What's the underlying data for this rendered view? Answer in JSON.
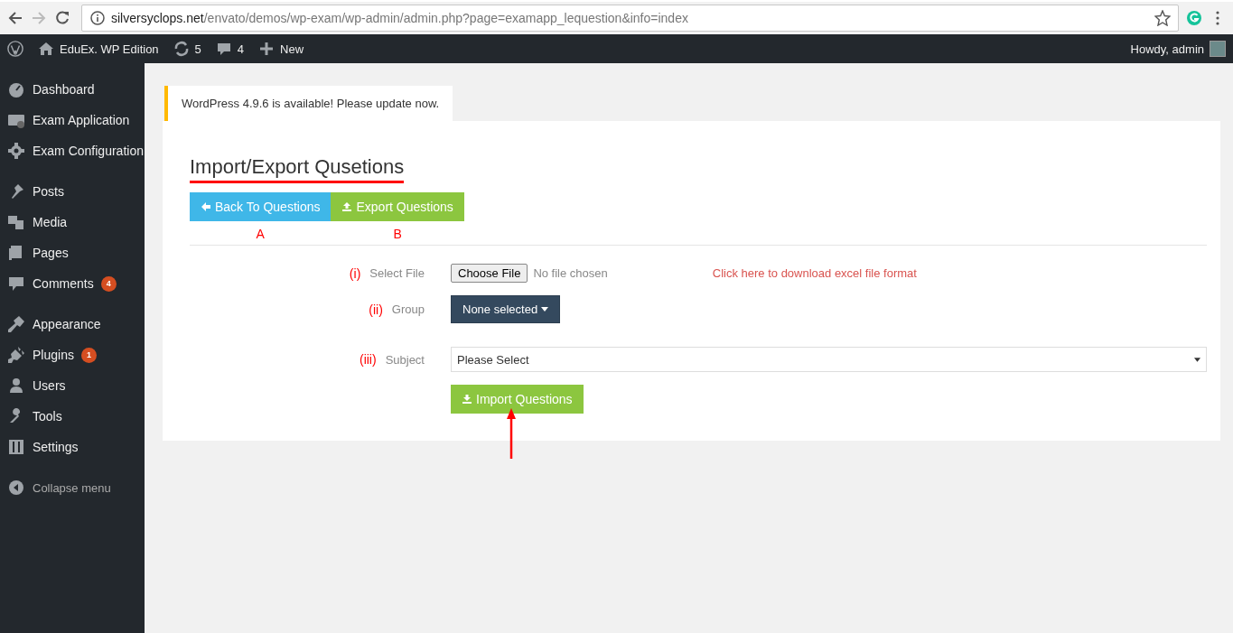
{
  "browser": {
    "url_host": "silversyclops.net",
    "url_path": "/envato/demos/wp-exam/wp-admin/admin.php?page=examapp_lequestion&info=index"
  },
  "admin_bar": {
    "site": "EduEx. WP Edition",
    "updates": "5",
    "comments": "4",
    "new": "New",
    "greeting": "Howdy, admin"
  },
  "sidebar": {
    "sections": [
      {
        "items": [
          {
            "label": "Dashboard"
          },
          {
            "label": "Exam Application"
          },
          {
            "label": "Exam Configuration"
          }
        ]
      },
      {
        "items": [
          {
            "label": "Posts"
          },
          {
            "label": "Media"
          },
          {
            "label": "Pages"
          },
          {
            "label": "Comments",
            "badge": "4"
          }
        ]
      },
      {
        "items": [
          {
            "label": "Appearance"
          },
          {
            "label": "Plugins",
            "badge": "1"
          },
          {
            "label": "Users"
          },
          {
            "label": "Tools"
          },
          {
            "label": "Settings"
          }
        ]
      }
    ],
    "collapse": "Collapse menu"
  },
  "notice": "WordPress 4.9.6 is available! Please update now.",
  "page": {
    "title": "Import/Export Qusetions",
    "buttons": [
      {
        "label": "Back To Questions",
        "kind": "back",
        "annotation": "A"
      },
      {
        "label": "Export Questions",
        "kind": "export",
        "annotation": "B"
      }
    ],
    "form": {
      "rows": [
        {
          "marker": "(i)",
          "label": "Select File",
          "kind": "file",
          "button": "Choose File",
          "value": "No file chosen",
          "link": "Click here to download excel file format"
        },
        {
          "marker": "(ii)",
          "label": "Group",
          "kind": "multiselect",
          "value": "None selected"
        },
        {
          "marker": "(iii)",
          "label": "Subject",
          "kind": "select",
          "value": "Please Select"
        }
      ],
      "submit": "Import Questions"
    }
  }
}
